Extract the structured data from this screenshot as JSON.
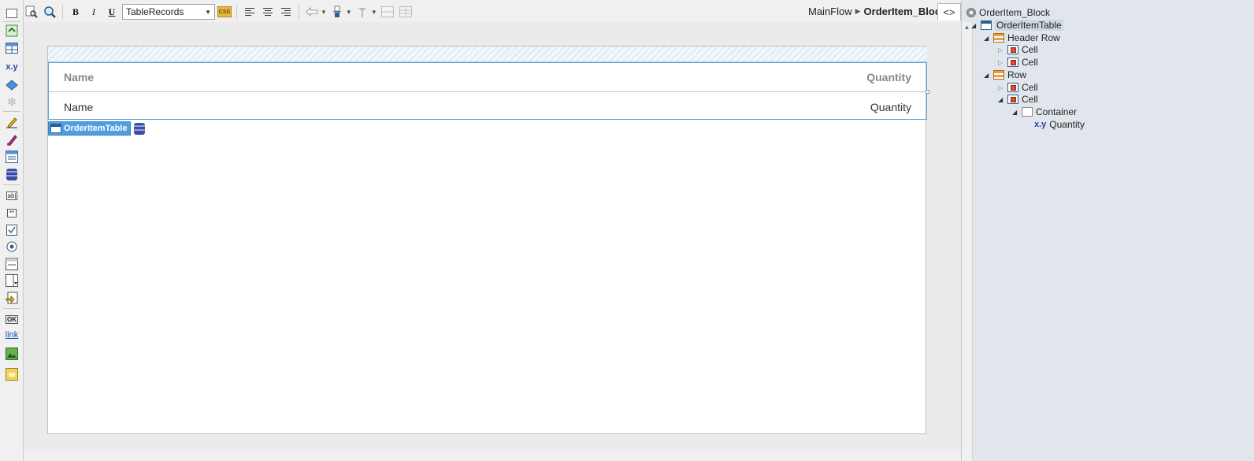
{
  "toolbar": {
    "style_select_value": "TableRecords",
    "css_label": "CSS",
    "bold_label": "B",
    "italic_label": "I",
    "underline_label": "U"
  },
  "breadcrumb": {
    "parent": "MainFlow",
    "current": "OrderItem_Block"
  },
  "code_toggle_label": "<>",
  "table": {
    "header": [
      "Name",
      "Quantity"
    ],
    "row": [
      "Name",
      "Quantity"
    ]
  },
  "widget_tag": "OrderItemTable",
  "palette": {
    "expression_label": "x.y",
    "button_label": "OK",
    "link_label": "link",
    "input_label": "ab|",
    "password_label": "**"
  },
  "tree": {
    "root": "OrderItem_Block",
    "table": "OrderItemTable",
    "header_row": "Header Row",
    "row": "Row",
    "cell": "Cell",
    "container": "Container",
    "expression_icon": "x.y",
    "expression": "Quantity"
  }
}
